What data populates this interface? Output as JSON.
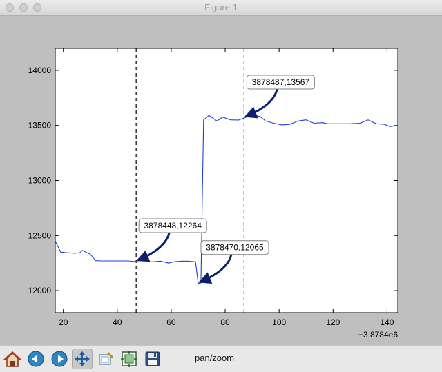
{
  "window": {
    "title": "Figure 1"
  },
  "toolbar": {
    "buttons": [
      {
        "name": "home-button",
        "icon": "home-icon"
      },
      {
        "name": "back-button",
        "icon": "back-arrow-icon"
      },
      {
        "name": "forward-button",
        "icon": "forward-arrow-icon"
      },
      {
        "name": "pan-button",
        "icon": "move-arrows-icon",
        "active": true
      },
      {
        "name": "zoom-button",
        "icon": "zoom-rect-icon"
      },
      {
        "name": "subplots-button",
        "icon": "subplots-icon"
      },
      {
        "name": "save-button",
        "icon": "floppy-disk-icon"
      }
    ],
    "message": "pan/zoom"
  },
  "chart_data": {
    "type": "line",
    "x_offset_label": "+3.8784e6",
    "xlim": [
      17,
      144
    ],
    "ylim": [
      11800,
      14200
    ],
    "x_ticks": [
      {
        "value": 20,
        "label": "20"
      },
      {
        "value": 40,
        "label": "40"
      },
      {
        "value": 60,
        "label": "60"
      },
      {
        "value": 80,
        "label": "80"
      },
      {
        "value": 100,
        "label": "100"
      },
      {
        "value": 120,
        "label": "120"
      },
      {
        "value": 140,
        "label": "140"
      }
    ],
    "y_ticks": [
      {
        "value": 12000,
        "label": "12000"
      },
      {
        "value": 12500,
        "label": "12500"
      },
      {
        "value": 13000,
        "label": "13000"
      },
      {
        "value": 13500,
        "label": "13500"
      },
      {
        "value": 14000,
        "label": "14000"
      }
    ],
    "grid": false,
    "line_color": "#1f3fcc",
    "series": [
      {
        "x": [
          17,
          19,
          21,
          24,
          26,
          27,
          30,
          32,
          34,
          38,
          41,
          44,
          47,
          50,
          53,
          56,
          59,
          61,
          64,
          66,
          69,
          70,
          71,
          72,
          74,
          77,
          79,
          82,
          85,
          87,
          90,
          93,
          95,
          98,
          101,
          104,
          107,
          110,
          113,
          116,
          118,
          122,
          126,
          130,
          133,
          136,
          139,
          141,
          144
        ],
        "y": [
          12450,
          12350,
          12345,
          12340,
          12342,
          12365,
          12330,
          12272,
          12270,
          12270,
          12270,
          12270,
          12264,
          12262,
          12262,
          12268,
          12250,
          12262,
          12268,
          12268,
          12262,
          12065,
          12070,
          13550,
          13590,
          13540,
          13575,
          13550,
          13548,
          13567,
          13595,
          13580,
          13540,
          13520,
          13505,
          13510,
          13540,
          13550,
          13520,
          13525,
          13515,
          13515,
          13515,
          13520,
          13550,
          13515,
          13510,
          13490,
          13500
        ]
      }
    ],
    "vlines": [
      47,
      87
    ],
    "annotations": [
      {
        "text": "3878448,12264",
        "x": 47,
        "y": 12264
      },
      {
        "text": "3878470,12065",
        "x": 70,
        "y": 12065
      },
      {
        "text": "3878487,13567",
        "x": 87,
        "y": 13567
      }
    ]
  }
}
